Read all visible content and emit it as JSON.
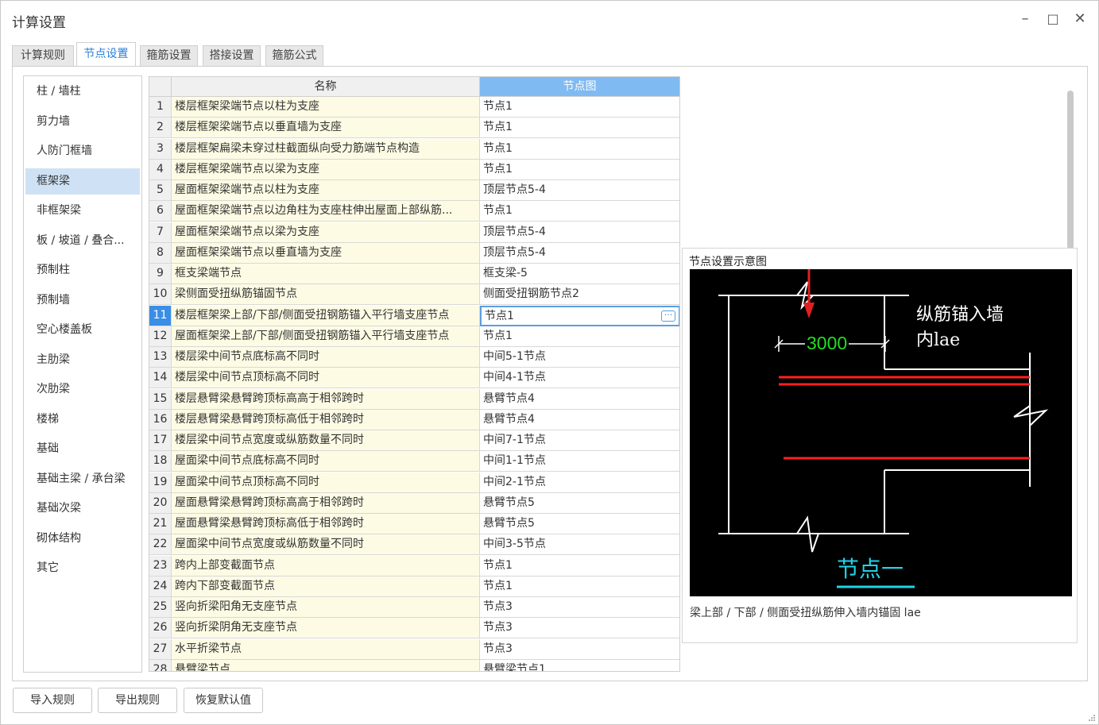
{
  "window": {
    "title": "计算设置",
    "minimize": "–",
    "maximize": "□",
    "close": "✕"
  },
  "tabs": [
    {
      "label": "计算规则"
    },
    {
      "label": "节点设置",
      "active": true
    },
    {
      "label": "箍筋设置"
    },
    {
      "label": "搭接设置"
    },
    {
      "label": "箍筋公式"
    }
  ],
  "sidebar": {
    "items": [
      {
        "label": "柱 / 墙柱"
      },
      {
        "label": "剪力墙"
      },
      {
        "label": "人防门框墙"
      },
      {
        "label": "框架梁",
        "active": true
      },
      {
        "label": "非框架梁"
      },
      {
        "label": "板 / 坡道 / 叠合..."
      },
      {
        "label": "预制柱"
      },
      {
        "label": "预制墙"
      },
      {
        "label": "空心楼盖板"
      },
      {
        "label": "主肋梁"
      },
      {
        "label": "次肋梁"
      },
      {
        "label": "楼梯"
      },
      {
        "label": "基础"
      },
      {
        "label": "基础主梁 / 承台梁"
      },
      {
        "label": "基础次梁"
      },
      {
        "label": "砌体结构"
      },
      {
        "label": "其它"
      }
    ]
  },
  "grid": {
    "headers": {
      "name": "名称",
      "node": "节点图"
    },
    "selected_row": 11,
    "rows": [
      {
        "num": "1",
        "name": "楼层框架梁端节点以柱为支座",
        "node": "节点1"
      },
      {
        "num": "2",
        "name": "楼层框架梁端节点以垂直墙为支座",
        "node": "节点1"
      },
      {
        "num": "3",
        "name": "楼层框架扁梁未穿过柱截面纵向受力筋端节点构造",
        "node": "节点1"
      },
      {
        "num": "4",
        "name": "楼层框架梁端节点以梁为支座",
        "node": "节点1"
      },
      {
        "num": "5",
        "name": "屋面框架梁端节点以柱为支座",
        "node": "顶层节点5-4"
      },
      {
        "num": "6",
        "name": "屋面框架梁端节点以边角柱为支座柱伸出屋面上部纵筋...",
        "node": "节点1"
      },
      {
        "num": "7",
        "name": "屋面框架梁端节点以梁为支座",
        "node": "顶层节点5-4"
      },
      {
        "num": "8",
        "name": "屋面框架梁端节点以垂直墙为支座",
        "node": "顶层节点5-4"
      },
      {
        "num": "9",
        "name": "框支梁端节点",
        "node": "框支梁-5"
      },
      {
        "num": "10",
        "name": "梁侧面受扭纵筋锚固节点",
        "node": "侧面受扭钢筋节点2"
      },
      {
        "num": "11",
        "name": "楼层框架梁上部/下部/侧面受扭钢筋锚入平行墙支座节点",
        "node": "节点1"
      },
      {
        "num": "12",
        "name": "屋面框架梁上部/下部/侧面受扭钢筋锚入平行墙支座节点",
        "node": "节点1"
      },
      {
        "num": "13",
        "name": "楼层梁中间节点底标高不同时",
        "node": "中间5-1节点"
      },
      {
        "num": "14",
        "name": "楼层梁中间节点顶标高不同时",
        "node": "中间4-1节点"
      },
      {
        "num": "15",
        "name": "楼层悬臂梁悬臂跨顶标高高于相邻跨时",
        "node": "悬臂节点4"
      },
      {
        "num": "16",
        "name": "楼层悬臂梁悬臂跨顶标高低于相邻跨时",
        "node": "悬臂节点4"
      },
      {
        "num": "17",
        "name": "楼层梁中间节点宽度或纵筋数量不同时",
        "node": "中间7-1节点"
      },
      {
        "num": "18",
        "name": "屋面梁中间节点底标高不同时",
        "node": "中间1-1节点"
      },
      {
        "num": "19",
        "name": "屋面梁中间节点顶标高不同时",
        "node": "中间2-1节点"
      },
      {
        "num": "20",
        "name": "屋面悬臂梁悬臂跨顶标高高于相邻跨时",
        "node": "悬臂节点5"
      },
      {
        "num": "21",
        "name": "屋面悬臂梁悬臂跨顶标高低于相邻跨时",
        "node": "悬臂节点5"
      },
      {
        "num": "22",
        "name": "屋面梁中间节点宽度或纵筋数量不同时",
        "node": "中间3-5节点"
      },
      {
        "num": "23",
        "name": "跨内上部变截面节点",
        "node": "节点1"
      },
      {
        "num": "24",
        "name": "跨内下部变截面节点",
        "node": "节点1"
      },
      {
        "num": "25",
        "name": "竖向折梁阳角无支座节点",
        "node": "节点3"
      },
      {
        "num": "26",
        "name": "竖向折梁阴角无支座节点",
        "node": "节点3"
      },
      {
        "num": "27",
        "name": "水平折梁节点",
        "node": "节点3"
      },
      {
        "num": "28",
        "name": "悬臂梁节点",
        "node": "悬臂梁节点1"
      }
    ]
  },
  "preview": {
    "title": "节点设置示意图",
    "dimension": "3000",
    "annotation_line1": "纵筋锚入墙",
    "annotation_line2": "内lae",
    "node_label": "节点一",
    "caption": "梁上部 / 下部 / 侧面受扭纵筋伸入墙内锚固 lae",
    "colors": {
      "background": "#000000",
      "rebar": "#ff2020",
      "dimension": "#22dd22",
      "label": "#22d3e6",
      "arrow": "#e02020"
    }
  },
  "buttons": {
    "import": "导入规则",
    "export": "导出规则",
    "restore": "恢复默认值"
  }
}
